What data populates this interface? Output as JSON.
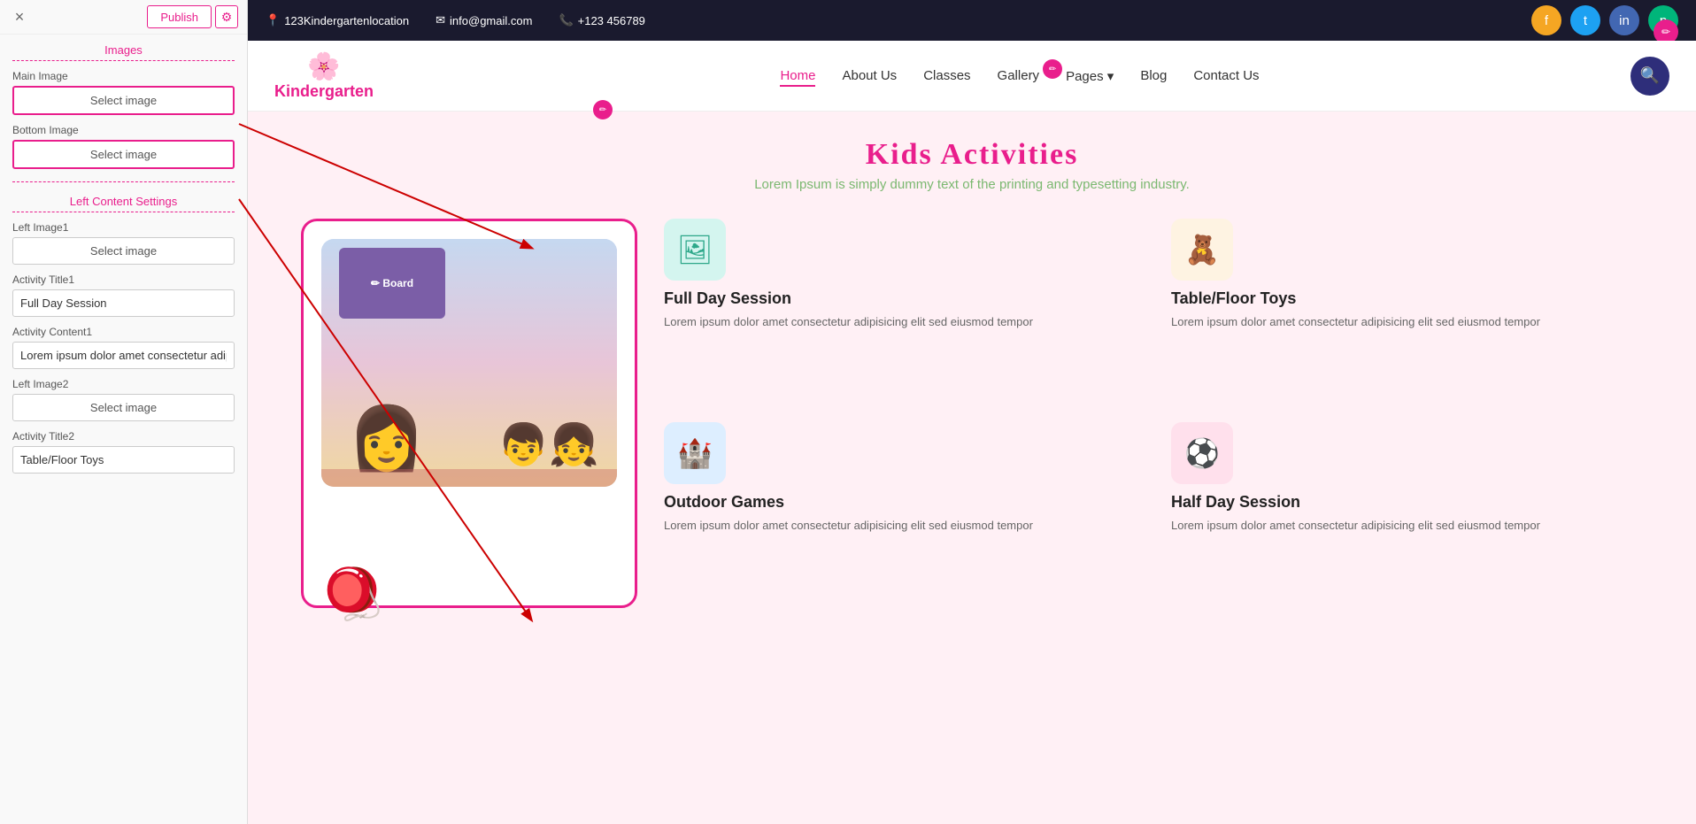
{
  "panel": {
    "close_label": "×",
    "publish_label": "Publish",
    "gear_label": "⚙",
    "sections": {
      "images_title": "Images",
      "main_image_label": "Main Image",
      "main_image_btn": "Select image",
      "bottom_image_label": "Bottom Image",
      "bottom_image_btn": "Select image",
      "left_content_title": "Left Content Settings",
      "left_image1_label": "Left Image1",
      "left_image1_btn": "Select image",
      "activity_title1_label": "Activity Title1",
      "activity_title1_value": "Full Day Session",
      "activity_content1_label": "Activity Content1",
      "activity_content1_value": "Lorem ipsum dolor amet consectetur adipiscing eli",
      "left_image2_label": "Left Image2",
      "left_image2_btn": "Select image",
      "activity_title2_label": "Activity Title2",
      "activity_title2_value": "Table/Floor Toys"
    }
  },
  "topbar": {
    "location_icon": "📍",
    "location_text": "123Kindergartenlocation",
    "email_icon": "✉",
    "email_text": "info@gmail.com",
    "phone_icon": "📞",
    "phone_text": "+123 456789",
    "social": {
      "facebook_icon": "f",
      "twitter_icon": "t",
      "instagram_icon": "in",
      "pinterest_icon": "p"
    }
  },
  "navbar": {
    "logo_top": "🌸",
    "logo_name": "Kindergarten",
    "logo_kinder": "Kinder",
    "logo_garten": "garten",
    "links": [
      {
        "label": "Home",
        "active": true
      },
      {
        "label": "About Us",
        "active": false
      },
      {
        "label": "Classes",
        "active": false
      },
      {
        "label": "Gallery",
        "active": false
      },
      {
        "label": "Pages",
        "active": false,
        "has_arrow": true
      },
      {
        "label": "Blog",
        "active": false
      },
      {
        "label": "Contact Us",
        "active": false
      }
    ],
    "search_icon": "🔍"
  },
  "hero": {
    "title": "Kids Activities",
    "subtitle": "Lorem Ipsum is simply dummy text of the printing and typesetting industry."
  },
  "activities": [
    {
      "icon": "🖼",
      "icon_style": "green",
      "icon_label": "abc-board-icon",
      "title": "Full Day Session",
      "description": "Lorem ipsum dolor amet consectetur adipisicing elit sed eiusmod tempor"
    },
    {
      "icon": "🧸",
      "icon_style": "orange",
      "icon_label": "teddy-bear-icon",
      "title": "Table/Floor Toys",
      "description": "Lorem ipsum dolor amet consectetur adipisicing elit sed eiusmod tempor"
    },
    {
      "icon": "🏰",
      "icon_style": "blue",
      "icon_label": "playground-icon",
      "title": "Outdoor Games",
      "description": "Lorem ipsum dolor amet consectetur adipisicing elit sed eiusmod tempor"
    },
    {
      "icon": "⚽",
      "icon_style": "pink",
      "icon_label": "soccer-ball-icon",
      "title": "Half Day Session",
      "description": "Lorem ipsum dolor amet consectetur adipisicing elit sed eiusmod tempor"
    }
  ],
  "colors": {
    "pink": "#e91e8c",
    "dark_blue": "#2e2e7a",
    "green": "#7bb870",
    "bg_pink": "#fff0f5"
  }
}
